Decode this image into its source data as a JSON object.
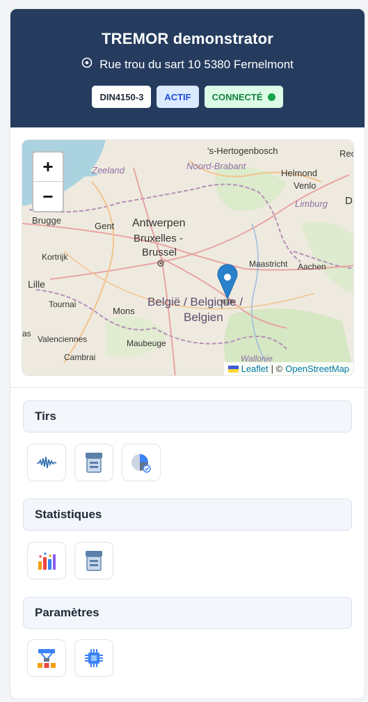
{
  "header": {
    "title": "TREMOR demonstrator",
    "address": "Rue trou du sart 10 5380 Fernelmont",
    "badges": {
      "din": "DIN4150-3",
      "actif": "ACTIF",
      "connecte": "CONNECTÉ"
    }
  },
  "map": {
    "zoom_in": "+",
    "zoom_out": "−",
    "labels": {
      "hertogenbosch": "'s-Hertogenbosch",
      "rec": "Rec",
      "zeeland": "Zeeland",
      "noord_brabant": "Noord-Brabant",
      "helmond": "Helmond",
      "venlo": "Venlo",
      "limburg": "Limburg",
      "d": "D",
      "brugge": "Brugge",
      "gent": "Gent",
      "antwerpen": "Antwerpen",
      "bruxelles": "Bruxelles -",
      "brussel": "Brussel",
      "kortrijk": "Kortrijk",
      "maastricht": "Maastricht",
      "aachen": "Aachen",
      "lille": "Lille",
      "tournai": "Tournai",
      "mons": "Mons",
      "belgie1": "België / Belgique /",
      "belgie2": "Belgien",
      "as": "as",
      "valenciennes": "Valenciennes",
      "maubeuge": "Maubeuge",
      "cambrai": "Cambrai",
      "wallonie": "Wallonie"
    },
    "attribution": {
      "leaflet": "Leaflet",
      "sep": "| ©",
      "osm": "OpenStreetMap"
    }
  },
  "sections": [
    {
      "title": "Tirs",
      "icons": [
        "waveform-icon",
        "archive-icon",
        "pie-chart-icon"
      ]
    },
    {
      "title": "Statistiques",
      "icons": [
        "bar-chart-icon",
        "archive-icon"
      ]
    },
    {
      "title": "Paramètres",
      "icons": [
        "hierarchy-icon",
        "chip-icon"
      ]
    }
  ],
  "colors": {
    "header_bg": "#253c5f",
    "marker": "#2a81cb",
    "accent_blue": "#1d4ed8",
    "status_green": "#16a34a"
  }
}
